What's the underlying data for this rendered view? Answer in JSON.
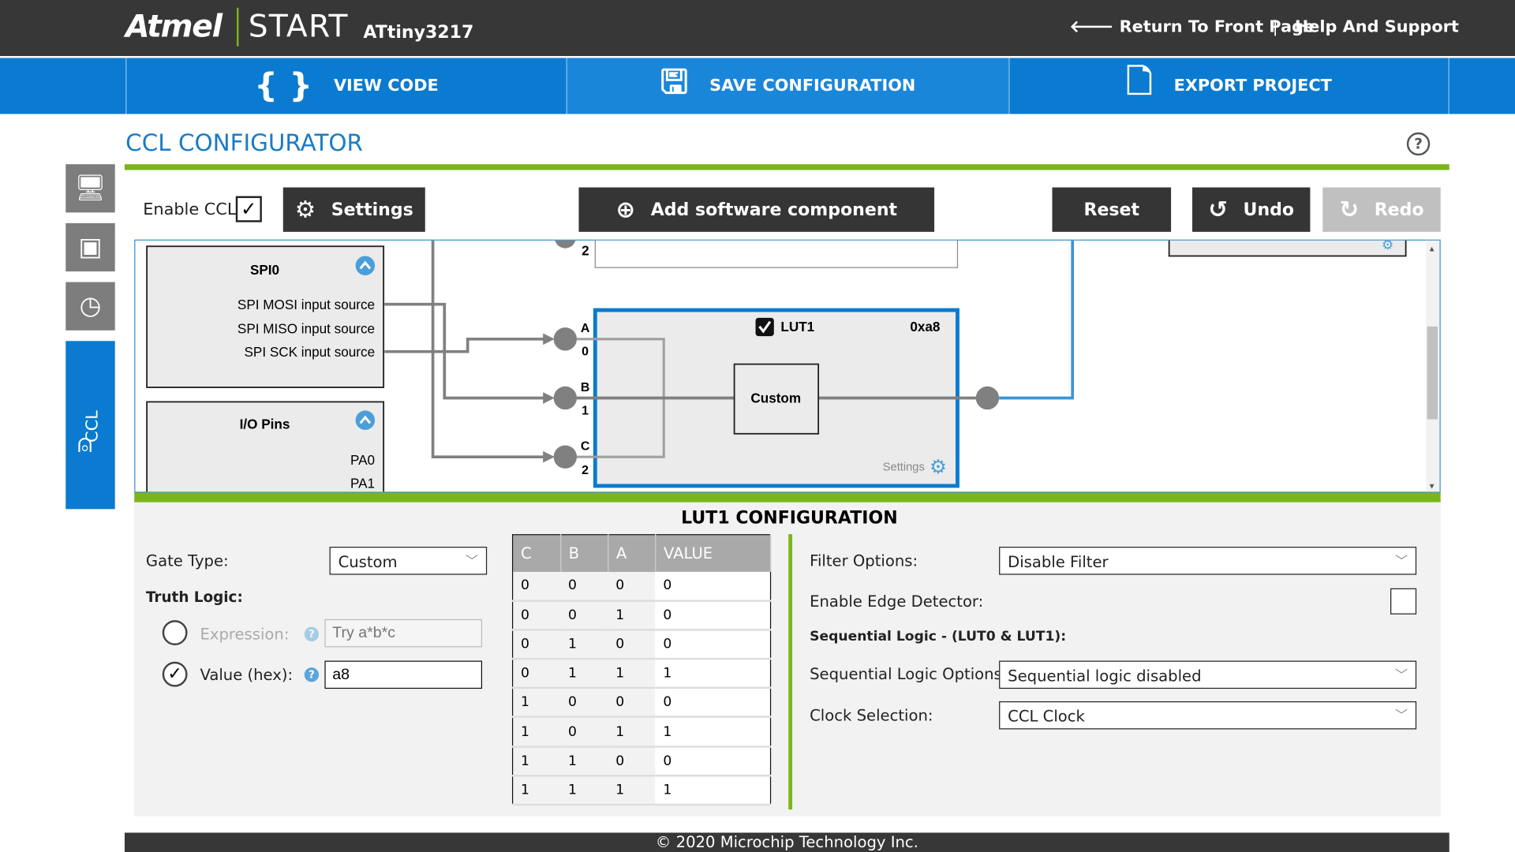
{
  "header": {
    "brand": "Atmel",
    "product": "START",
    "device": "ATtiny3217",
    "links": [
      {
        "label": "Return To Front Page",
        "icon": "arrow-left-icon"
      },
      {
        "label": "Help And Support"
      }
    ],
    "separator": "|"
  },
  "actions": [
    {
      "label": "VIEW CODE",
      "icon": "braces-icon"
    },
    {
      "label": "SAVE CONFIGURATION",
      "icon": "floppy-disk-icon"
    },
    {
      "label": "EXPORT PROJECT",
      "icon": "export-file-icon"
    }
  ],
  "page": {
    "title": "CCL CONFIGURATOR",
    "help": "?"
  },
  "sidebar": {
    "items": [
      {
        "icon": "dashboard-icon"
      },
      {
        "icon": "chip-icon"
      },
      {
        "icon": "clock-icon"
      },
      {
        "label": "CCL",
        "icon": "ccl-gate-icon",
        "active": true
      }
    ]
  },
  "toolbar": {
    "enable_label": "Enable CCL",
    "enable_checked": true,
    "settings": "Settings",
    "add": "Add software component",
    "reset": "Reset",
    "undo": "Undo",
    "redo": "Redo"
  },
  "diagram": {
    "spi": {
      "title": "SPI0",
      "items": [
        "SPI MOSI input source",
        "SPI MISO input source",
        "SPI SCK input source"
      ]
    },
    "io": {
      "title": "I/O Pins",
      "items": [
        "PA0",
        "PA1"
      ]
    },
    "top_label": "2",
    "inputs": [
      {
        "letter": "A",
        "index": "0"
      },
      {
        "letter": "B",
        "index": "1"
      },
      {
        "letter": "C",
        "index": "2"
      }
    ],
    "lut": {
      "name": "LUT1",
      "value": "0xa8",
      "checked": true,
      "gate": "Custom",
      "settings": "Settings"
    }
  },
  "config": {
    "title": "LUT1 CONFIGURATION",
    "gate_type_label": "Gate Type:",
    "gate_type": "Custom",
    "truth_logic_label": "Truth Logic:",
    "expression_label": "Expression:",
    "expression_placeholder": "Try a*b*c",
    "expression_selected": false,
    "value_label": "Value (hex):",
    "value": "a8",
    "value_selected": true,
    "table": {
      "headers": [
        "C",
        "B",
        "A",
        "VALUE"
      ],
      "rows": [
        [
          "0",
          "0",
          "0",
          "0"
        ],
        [
          "0",
          "0",
          "1",
          "0"
        ],
        [
          "0",
          "1",
          "0",
          "0"
        ],
        [
          "0",
          "1",
          "1",
          "1"
        ],
        [
          "1",
          "0",
          "0",
          "0"
        ],
        [
          "1",
          "0",
          "1",
          "1"
        ],
        [
          "1",
          "1",
          "0",
          "0"
        ],
        [
          "1",
          "1",
          "1",
          "1"
        ]
      ]
    },
    "filter_label": "Filter Options:",
    "filter": "Disable Filter",
    "edge_label": "Enable Edge Detector:",
    "edge_checked": false,
    "seq_heading": "Sequential Logic - (LUT0 & LUT1):",
    "seq_label": "Sequential Logic Options:",
    "seq": "Sequential logic disabled",
    "clock_label": "Clock Selection:",
    "clock": "CCL Clock"
  },
  "footer": "© 2020 Microchip Technology Inc.",
  "colors": {
    "header": "#373737",
    "accent": "#0a7bd0",
    "green": "#7ab51d",
    "button": "#353535",
    "disabled": "#c0c0c0"
  }
}
